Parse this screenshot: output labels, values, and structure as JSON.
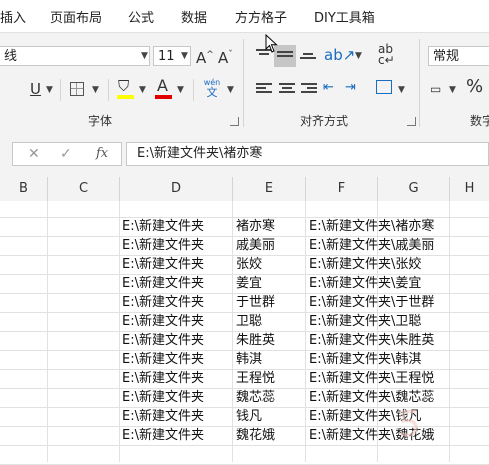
{
  "ribbon_tabs": [
    "插入",
    "页面布局",
    "公式",
    "数据",
    "方方格子",
    "DIY工具箱"
  ],
  "font": {
    "name_value": "线",
    "size_value": "11",
    "group_label": "字体",
    "grow_icon": "A^",
    "shrink_icon": "Aˇ",
    "underline_icon": "U",
    "wen_top": "wén",
    "wen_bottom": "文",
    "colors": {
      "highlight": "#ffff00",
      "font_color": "#e00000"
    }
  },
  "alignment": {
    "group_label": "对齐方式"
  },
  "number": {
    "format_value": "常规",
    "group_label": "数字",
    "percent_icon": "%"
  },
  "formula_bar": {
    "fx": "fx",
    "content": "E:\\新建文件夹\\褚亦寒"
  },
  "columns": [
    "B",
    "C",
    "D",
    "E",
    "F",
    "G",
    "H"
  ],
  "rows": [
    {
      "d": "E:\\新建文件夹",
      "e": "褚亦寒",
      "f": "E:\\新建文件夹\\褚亦寒"
    },
    {
      "d": "E:\\新建文件夹",
      "e": "戚美丽",
      "f": "E:\\新建文件夹\\戚美丽"
    },
    {
      "d": "E:\\新建文件夹",
      "e": "张姣",
      "f": "E:\\新建文件夹\\张姣"
    },
    {
      "d": "E:\\新建文件夹",
      "e": "姜宜",
      "f": "E:\\新建文件夹\\姜宜"
    },
    {
      "d": "E:\\新建文件夹",
      "e": "于世群",
      "f": "E:\\新建文件夹\\于世群"
    },
    {
      "d": "E:\\新建文件夹",
      "e": "卫聪",
      "f": "E:\\新建文件夹\\卫聪"
    },
    {
      "d": "E:\\新建文件夹",
      "e": "朱胜英",
      "f": "E:\\新建文件夹\\朱胜英"
    },
    {
      "d": "E:\\新建文件夹",
      "e": "韩淇",
      "f": "E:\\新建文件夹\\韩淇"
    },
    {
      "d": "E:\\新建文件夹",
      "e": "王程悦",
      "f": "E:\\新建文件夹\\王程悦"
    },
    {
      "d": "E:\\新建文件夹",
      "e": "魏芯蕊",
      "f": "E:\\新建文件夹\\魏芯蕊"
    },
    {
      "d": "E:\\新建文件夹",
      "e": "钱凡",
      "f": "E:\\新建文件夹\\钱凡"
    },
    {
      "d": "E:\\新建文件夹",
      "e": "魏花娥",
      "f": "E:\\新建文件夹\\魏花娥"
    }
  ],
  "watermark": "5"
}
